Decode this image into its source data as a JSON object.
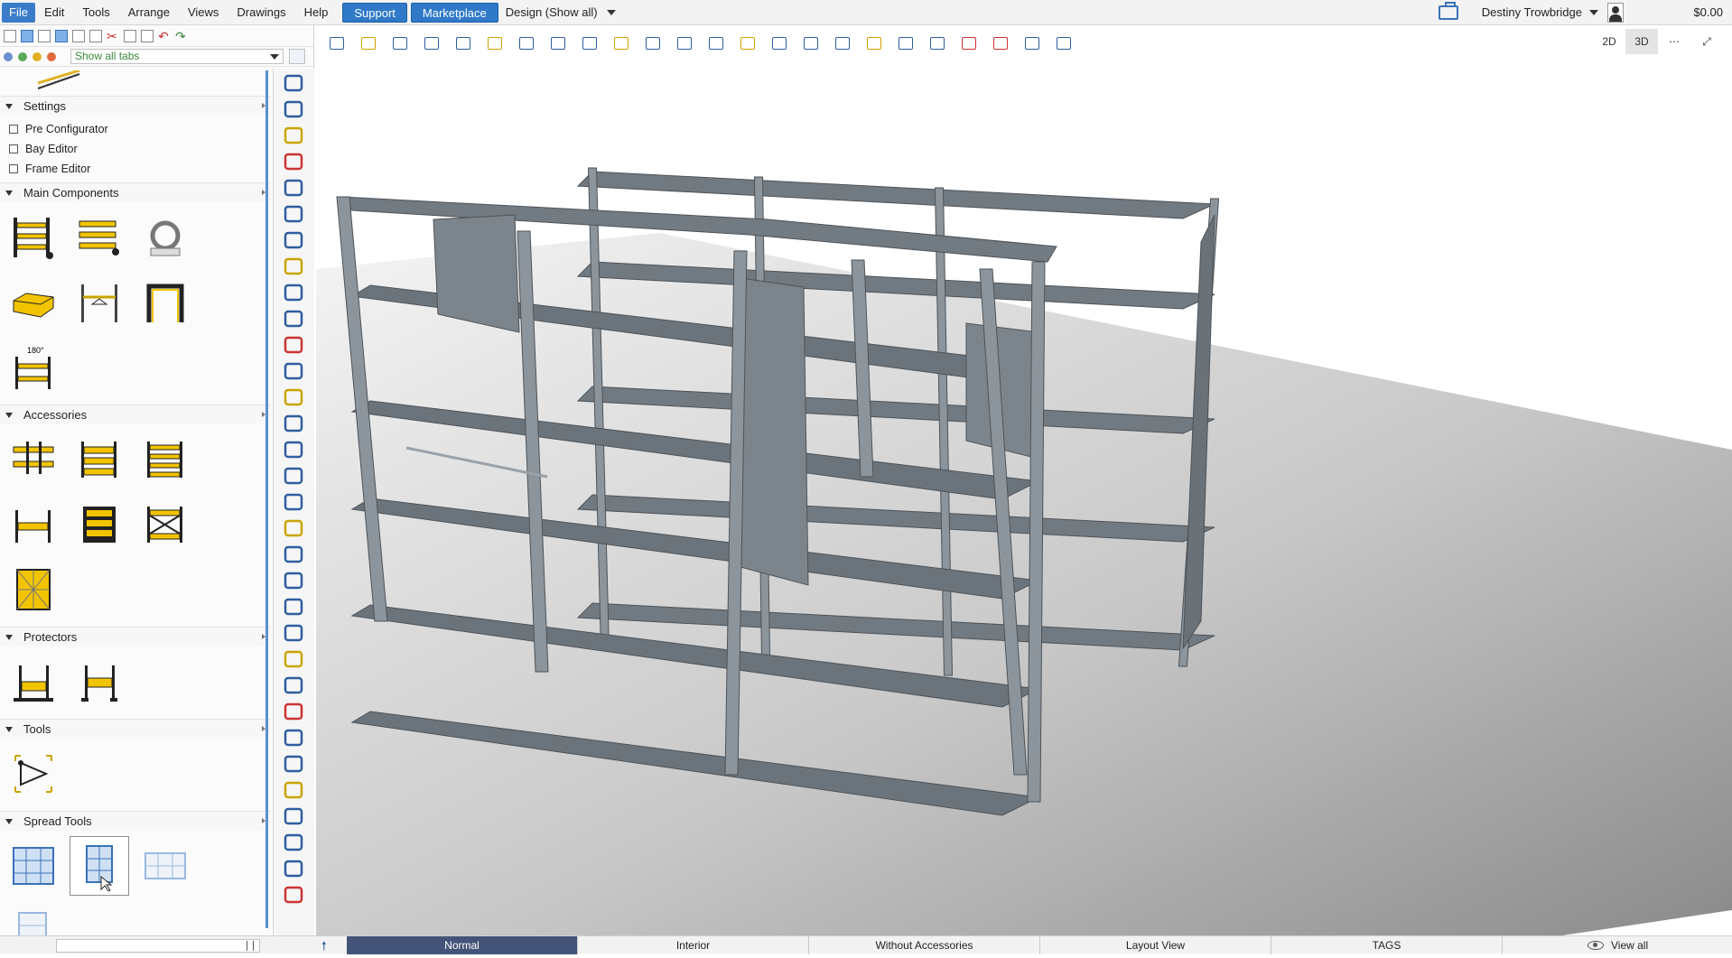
{
  "menu": {
    "file": "File",
    "edit": "Edit",
    "tools": "Tools",
    "arrange": "Arrange",
    "views": "Views",
    "drawings": "Drawings",
    "help": "Help",
    "support": "Support",
    "marketplace": "Marketplace",
    "design": "Design (Show all)"
  },
  "user": {
    "name": "Destiny Trowbridge",
    "balance": "$0.00"
  },
  "left": {
    "tab_filter": "Show all tabs",
    "settings": {
      "title": "Settings",
      "items": [
        "Pre Configurator",
        "Bay Editor",
        "Frame Editor"
      ]
    },
    "main_components": {
      "title": "Main Components",
      "badge": "180°"
    },
    "accessories": {
      "title": "Accessories"
    },
    "protectors": {
      "title": "Protectors"
    },
    "tools": {
      "title": "Tools"
    },
    "spread_tools": {
      "title": "Spread Tools"
    }
  },
  "view_modes": {
    "two_d": "2D",
    "three_d": "3D"
  },
  "bottom_tabs": [
    "Normal",
    "Interior",
    "Without Accessories",
    "Layout View",
    "TAGS"
  ],
  "active_tab": "Normal",
  "view_all": "View all",
  "colors": {
    "accent": "#2f79c8",
    "active_tab": "#445378",
    "shelf": "#6e767d",
    "upright": "#8d959c",
    "panel": "#7d858c",
    "floor_light": "#ececec",
    "floor_dark": "#8a8a8a",
    "component_yellow": "#f2c400"
  }
}
